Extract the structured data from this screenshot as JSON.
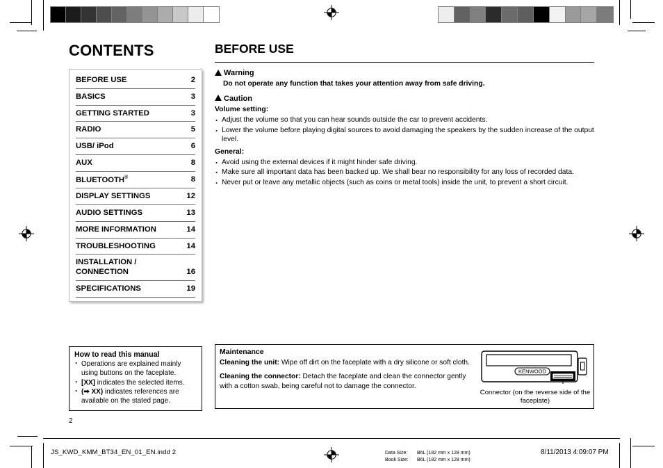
{
  "page": {
    "folio": "2",
    "contents_heading": "CONTENTS",
    "section_heading": "BEFORE USE"
  },
  "toc": {
    "rows": [
      {
        "label": "BEFORE USE",
        "sup": "",
        "page": "2"
      },
      {
        "label": "BASICS",
        "sup": "",
        "page": "3"
      },
      {
        "label": "GETTING STARTED",
        "sup": "",
        "page": "3"
      },
      {
        "label": "RADIO",
        "sup": "",
        "page": "5"
      },
      {
        "label": "USB/ iPod",
        "sup": "",
        "page": "6"
      },
      {
        "label": "AUX",
        "sup": "",
        "page": "8"
      },
      {
        "label": "BLUETOOTH",
        "sup": "®",
        "page": "8"
      },
      {
        "label": "DISPLAY SETTINGS",
        "sup": "",
        "page": "12"
      },
      {
        "label": "AUDIO SETTINGS",
        "sup": "",
        "page": "13"
      },
      {
        "label": "MORE INFORMATION",
        "sup": "",
        "page": "14"
      },
      {
        "label": "TROUBLESHOOTING",
        "sup": "",
        "page": "14"
      },
      {
        "label": "INSTALLATION / CONNECTION",
        "sup": "",
        "page": "16"
      },
      {
        "label": "SPECIFICATIONS",
        "sup": "",
        "page": "19"
      }
    ]
  },
  "before_use": {
    "warning_title": "Warning",
    "warning_text": "Do not operate any function that takes your attention away from safe driving.",
    "caution_title": "Caution",
    "volume_label": "Volume setting:",
    "volume_items": [
      "Adjust the volume so that you can hear sounds outside the car to prevent accidents.",
      "Lower the volume before playing digital sources to avoid damaging the speakers by the sudden increase of the output level."
    ],
    "general_label": "General:",
    "general_items": [
      "Avoid using the external devices if it might hinder safe driving.",
      "Make sure all important data has been backed up. We shall bear no responsibility for any loss of recorded data.",
      "Never put or leave any metallic objects (such as coins or metal tools) inside the unit, to prevent a short circuit."
    ]
  },
  "how_to_read": {
    "title": "How to read this manual",
    "items": [
      "Operations are explained mainly using buttons on the faceplate.",
      "[XX] indicates the selected items.",
      "(➡ XX) indicates references are available on the stated page."
    ]
  },
  "maintenance": {
    "title": "Maintenance",
    "para1_label": "Cleaning the unit:",
    "para1_text": " Wipe off dirt on the faceplate with a dry silicone or soft cloth.",
    "para2_label": "Cleaning the connector:",
    "para2_text": " Detach the faceplate and clean the connector gently with a cotton swab, being careful not to damage the connector.",
    "faceplate_brand": "KENWOOD",
    "caption": "Connector (on the reverse side of the faceplate)"
  },
  "footer": {
    "file_name": "JS_KWD_KMM_BT34_EN_01_EN.indd   2",
    "data_size_label": "Data Size:",
    "data_size_value": "B6L (182 mm x 128 mm)",
    "book_size_label": "Book Size:",
    "book_size_value": "B6L (182 mm x 128 mm)",
    "date": "8/11/2013   4:09:07 PM"
  },
  "print_marks": {
    "wedge_left": [
      "#000000",
      "#1b1b1b",
      "#333333",
      "#4d4d4d",
      "#636363",
      "#7d7d7d",
      "#949494",
      "#ababab",
      "#c8c8c8",
      "#ececec",
      "#ffffff"
    ],
    "wedge_right": [
      "#ededed",
      "#626262",
      "#808080",
      "#2b2b2b",
      "#6b6b6b",
      "#5e5e5e",
      "#000000",
      "#f2f2f2",
      "#9a9a9a",
      "#a5a5a5",
      "#7b7b7b"
    ]
  }
}
